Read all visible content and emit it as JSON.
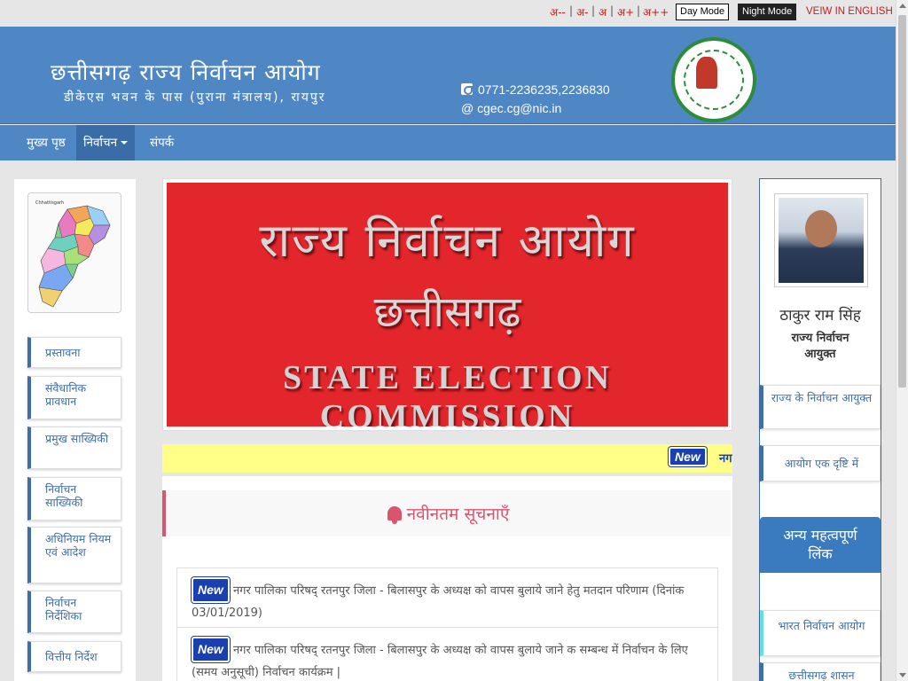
{
  "topbar": {
    "font_controls": [
      "अ--",
      "अ-",
      "अ",
      "अ+",
      "अ++"
    ],
    "day_mode": "Day Mode",
    "night_mode": "Night Mode",
    "english": "VEIW IN ENGLISH"
  },
  "header": {
    "title": "छत्तीसगढ़ राज्य निर्वाचन आयोग",
    "subtitle": "डीकेएस भवन के पास (पुराना मंत्रालय), रायपुर",
    "phone": "0771-2236235,2236830",
    "email": "@ cgec.cg@nic.in",
    "emblem_icon": "state-election-commission-seal"
  },
  "nav": {
    "items": [
      "मुख्य पृष्ठ",
      "निर्वाचन",
      "संपर्क"
    ]
  },
  "left_nav": {
    "map_label": "Chhattisgarh",
    "items": [
      "प्रस्तावना",
      "संवैधानिक प्रावधान",
      "प्रमुख साख्यिकी",
      "निर्वाचन साख्यिकी",
      "अधिनियम नियम एवं आदेश",
      "निर्वाचन निर्देशिका",
      "वित्तीय निर्देश"
    ]
  },
  "banner": {
    "line1": "राज्य निर्वाचन आयोग",
    "line2": "छत्तीसगढ़",
    "line3": "STATE ELECTION COMMISSION"
  },
  "ticker": {
    "badge": "New",
    "text": "नग"
  },
  "notices": {
    "heading": "नवीनतम सूचनाएँ",
    "badge": "New",
    "items": [
      "नगर पालिका परिषद् रतनपुर जिला - बिलासपुर के अध्यक्ष को वापस बुलाये जाने हेतु मतदान परिणाम (दिनांक 03/01/2019)",
      "नगर पालिका परिषद् रतनपुर जिला - बिलासपुर के अध्यक्ष को वापस बुलाये जाने क सम्बन्ध में निर्वाचन के लिए (समय अनुसूची) निर्वाचन कार्यक्रम |"
    ]
  },
  "commissioner": {
    "name": "ठाकुर राम सिंह",
    "title": "राज्य निर्वाचन आयुक्त"
  },
  "right_nav": {
    "items": [
      "राज्य के निर्वाचन आयुक्त",
      "आयोग एक दृष्टि में"
    ],
    "links_heading": "अन्य महत्वपूर्ण लिंक",
    "links": [
      "भारत निर्वाचन आयोग",
      "छत्तीसगढ़ शासन"
    ]
  },
  "colors": {
    "header_blue": "#4f87c5",
    "accent_red": "#d01a1a",
    "notice_pink": "#d9546f",
    "ticker_yellow": "#ffff88"
  }
}
